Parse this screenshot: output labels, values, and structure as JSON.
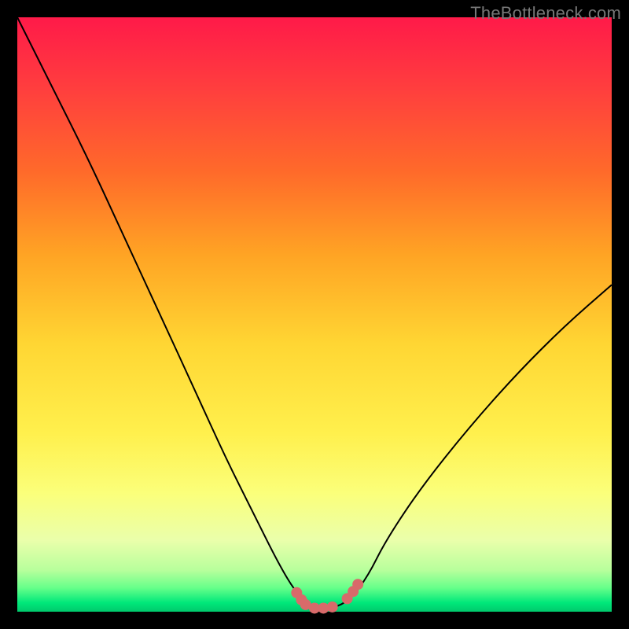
{
  "watermark": "TheBottleneck.com",
  "chart_data": {
    "type": "line",
    "title": "",
    "xlabel": "",
    "ylabel": "",
    "xlim": [
      0,
      100
    ],
    "ylim": [
      0,
      100
    ],
    "series": [
      {
        "name": "bottleneck-curve",
        "x": [
          0,
          6,
          12,
          18,
          24,
          30,
          35,
          40,
          44,
          47,
          50,
          53,
          56,
          59,
          62,
          68,
          76,
          84,
          92,
          100
        ],
        "values": [
          100,
          88,
          76,
          63,
          50,
          37,
          26,
          16,
          8,
          3,
          0.5,
          0.5,
          2,
          6,
          12,
          21,
          31,
          40,
          48,
          55
        ]
      },
      {
        "name": "valley-dots",
        "x": [
          47.0,
          47.8,
          48.5,
          50.0,
          51.5,
          53.0,
          55.5,
          56.5,
          57.3
        ],
        "values": [
          3.2,
          2.0,
          1.2,
          0.6,
          0.6,
          0.8,
          2.2,
          3.4,
          4.6
        ]
      }
    ],
    "colors": {
      "curve": "#000000",
      "dots": "#d86a6a"
    }
  }
}
